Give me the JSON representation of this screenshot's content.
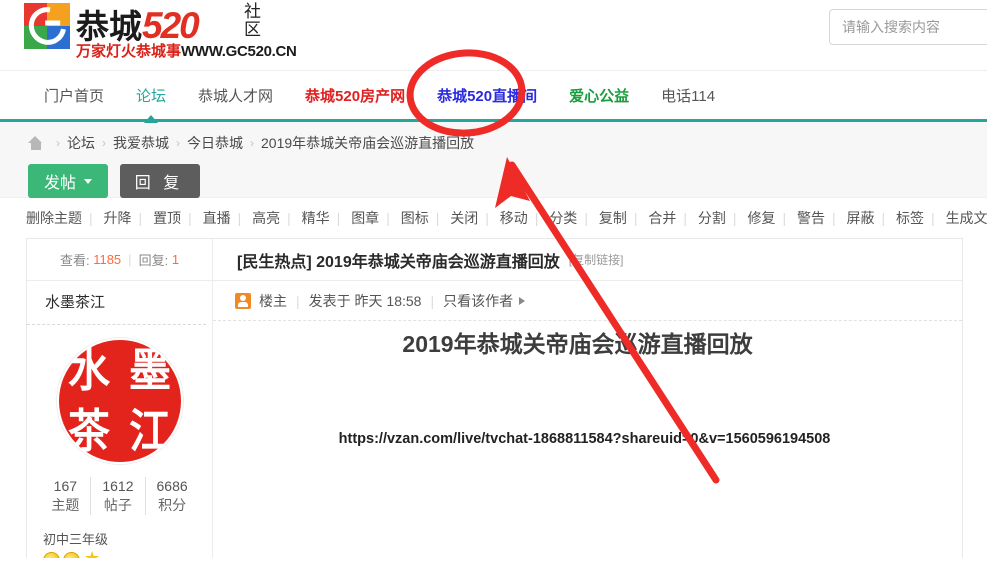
{
  "site": {
    "logo_cn": "恭城",
    "logo_520": "520",
    "logo_shequ": "社区",
    "slogan_cn": "万家灯火恭城事",
    "slogan_en": "WWW.GC520.CN"
  },
  "search": {
    "placeholder": "请输入搜索内容",
    "value": ""
  },
  "nav": {
    "items": [
      {
        "label": "门户首页",
        "color": "#555555",
        "active": false,
        "bold": false
      },
      {
        "label": "论坛",
        "color": "#26a69a",
        "active": true,
        "bold": false
      },
      {
        "label": "恭城人才网",
        "color": "#555555",
        "active": false,
        "bold": false
      },
      {
        "label": "恭城520房产网",
        "color": "#e02020",
        "active": false,
        "bold": true
      },
      {
        "label": "恭城520直播间",
        "color": "#2a2ae0",
        "active": false,
        "bold": true
      },
      {
        "label": "爱心公益",
        "color": "#1a9c3c",
        "active": false,
        "bold": true
      },
      {
        "label": "电话114",
        "color": "#666666",
        "active": false,
        "bold": false
      }
    ],
    "underline_color": "#26a69a"
  },
  "breadcrumb": {
    "home_icon": "home-icon",
    "separator": "›",
    "items": [
      "论坛",
      "我爱恭城",
      "今日恭城",
      "2019年恭城关帝庙会巡游直播回放"
    ]
  },
  "actions": {
    "post_label": "发帖",
    "reply_label": "回 复",
    "post_color": "#3bb878",
    "reply_color": "#5d5d5d"
  },
  "admin_bar": {
    "ops": [
      "删除主题",
      "升降",
      "置顶",
      "直播",
      "高亮",
      "精华",
      "图章",
      "图标",
      "关闭",
      "移动",
      "分类",
      "复制",
      "合并",
      "分割",
      "修复",
      "警告",
      "屏蔽",
      "标签",
      "生成文章"
    ]
  },
  "thread": {
    "views_label": "查看:",
    "views_count": "1185",
    "replies_label": "回复:",
    "replies_count": "1",
    "category_tag": "[民生热点]",
    "title": "2019年恭城关帝庙会巡游直播回放",
    "copy_link": "[复制链接]"
  },
  "author": {
    "name": "水墨茶江",
    "avatar_chars": [
      "水",
      "墨",
      "茶",
      "江"
    ],
    "avatar_color": "#e3241c",
    "stats": [
      {
        "value": "167",
        "label": "主题"
      },
      {
        "value": "1612",
        "label": "帖子"
      },
      {
        "value": "6686",
        "label": "积分"
      }
    ],
    "rank": "初中三年级",
    "medals": [
      "smiley-medal-icon",
      "smiley-medal-icon",
      "star-medal-icon"
    ]
  },
  "post": {
    "badge": "楼主",
    "posted_prefix": "发表于",
    "posted_time": "昨天 18:58",
    "only_author": "只看该作者",
    "content_title": "2019年恭城关帝庙会巡游直播回放",
    "content_url": "https://vzan.com/live/tvchat-1868811584?shareuid=0&v=1560596194508"
  },
  "annotation": {
    "color": "#ee2b26",
    "circle_target": "恭城520直播间",
    "arrow_from": "post-url",
    "arrow_to": "nav-live-room"
  }
}
